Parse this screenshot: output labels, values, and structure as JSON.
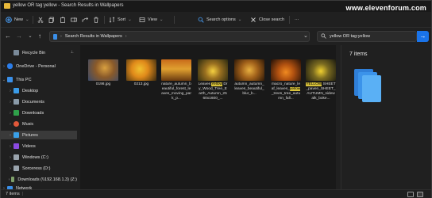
{
  "window": {
    "title": "yellow OR tag:yellow - Search Results in Wallpapers",
    "watermark": "www.elevenforum.com"
  },
  "toolbar": {
    "new_label": "New",
    "sort_label": "Sort",
    "view_label": "View",
    "search_options_label": "Search options",
    "close_search_label": "Close search",
    "more_label": "···"
  },
  "address": {
    "path": "Search Results in Wallpapers"
  },
  "search": {
    "value": "yellow OR tag:yellow"
  },
  "sidebar": {
    "items": [
      {
        "label": "Recycle Bin",
        "icon": "recycle-bin-icon"
      },
      {
        "label": "OneDrive - Personal",
        "icon": "cloud-icon"
      },
      {
        "label": "This PC",
        "icon": "computer-icon"
      },
      {
        "label": "Desktop",
        "icon": "desktop-icon"
      },
      {
        "label": "Documents",
        "icon": "documents-icon"
      },
      {
        "label": "Downloads",
        "icon": "downloads-icon"
      },
      {
        "label": "Music",
        "icon": "music-icon"
      },
      {
        "label": "Pictures",
        "icon": "pictures-icon"
      },
      {
        "label": "Videos",
        "icon": "videos-icon"
      },
      {
        "label": "Windows (C:)",
        "icon": "drive-icon"
      },
      {
        "label": "Sorceress (D:)",
        "icon": "drive-icon"
      },
      {
        "label": "Downloads (\\\\192.168.1.3) (Z:)",
        "icon": "network-drive-icon"
      },
      {
        "label": "Network",
        "icon": "network-icon"
      }
    ]
  },
  "files": [
    {
      "name": "0198.jpg"
    },
    {
      "name": "0213.jpg"
    },
    {
      "name": "nature_autumn_beautiful_forest_leaves_moving_park_p..."
    },
    {
      "pre": "Leaves ",
      "hl": "Yellow",
      "post": " Dry_Wood_Tree_Earth_Autumn_2560x1600_..."
    },
    {
      "name": "autumn_autumn_leaves_beautiful_blur_b..."
    },
    {
      "pre": "macro_nature_leaf_leaves_",
      "hl": "yellow",
      "post": "_trees_tree_autumn_fall..."
    },
    {
      "hl": "YELLOW",
      "post": " SHEET_paven_SHEET_AUTUMN_sidewalk_boke..."
    }
  ],
  "details": {
    "count": "7 items"
  },
  "status": {
    "count": "7 items",
    "separator": "|"
  },
  "colors": {
    "accent": "#1a73e8",
    "highlight": "#d8c23a",
    "folder": "#e8b93a"
  }
}
